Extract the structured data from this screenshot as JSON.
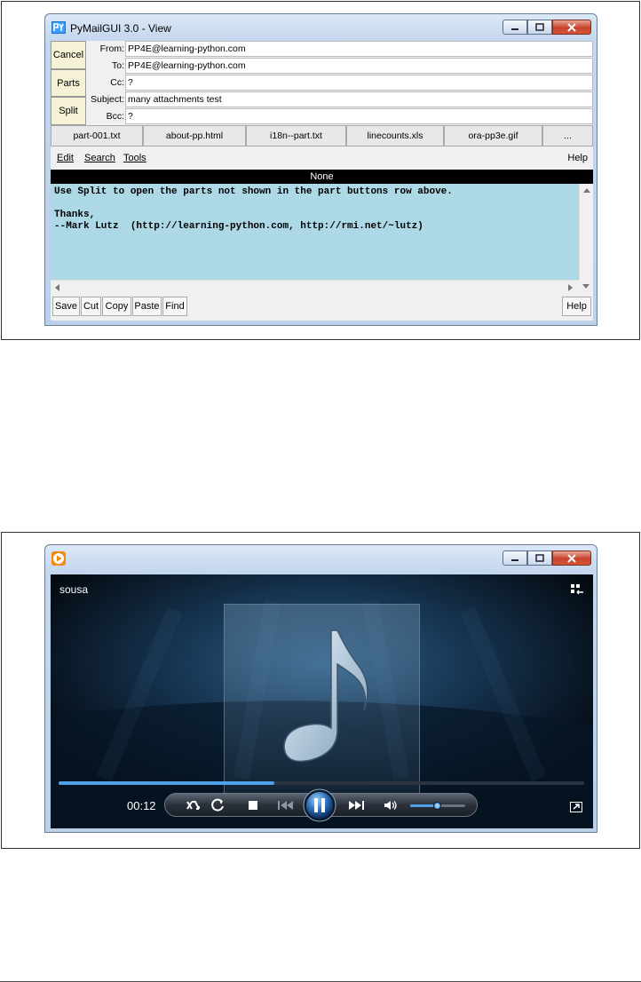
{
  "pymailgui": {
    "window_title": "PyMailGUI 3.0 - View",
    "side_buttons": {
      "cancel": "Cancel",
      "parts": "Parts",
      "split": "Split"
    },
    "headers": [
      {
        "label": "From:",
        "value": "PP4E@learning-python.com"
      },
      {
        "label": "To:",
        "value": "PP4E@learning-python.com"
      },
      {
        "label": "Cc:",
        "value": "?"
      },
      {
        "label": "Subject:",
        "value": "many attachments test"
      },
      {
        "label": "Bcc:",
        "value": "?"
      }
    ],
    "parts": [
      "part-001.txt",
      "about-pp.html",
      "i18n--part.txt",
      "linecounts.xls",
      "ora-pp3e.gif",
      "..."
    ],
    "menus": {
      "edit": "Edit",
      "search": "Search",
      "tools": "Tools",
      "help": "Help"
    },
    "status": "None",
    "body_lines": [
      "Use Split to open the parts not shown in the part buttons row above.",
      "",
      "Thanks,",
      "--Mark Lutz  (http://learning-python.com, http://rmi.net/~lutz)"
    ],
    "toolbar": {
      "save": "Save",
      "cut": "Cut",
      "copy": "Copy",
      "paste": "Paste",
      "find": "Find",
      "help": "Help"
    },
    "colors": {
      "body_bg": "#add8e6",
      "side_button_bg": "#f5f2d6"
    }
  },
  "media_player": {
    "track_title": "sousa",
    "elapsed": "00:12",
    "progress": 0.41,
    "volume": 0.5,
    "state": "playing",
    "icons": [
      "shuffle-icon",
      "repeat-icon",
      "stop-icon",
      "previous-icon",
      "pause-icon",
      "next-icon",
      "volume-icon",
      "switch-to-library-icon",
      "fullscreen-icon",
      "music-note-icon"
    ],
    "colors": {
      "accent": "#4fa0e6"
    }
  }
}
